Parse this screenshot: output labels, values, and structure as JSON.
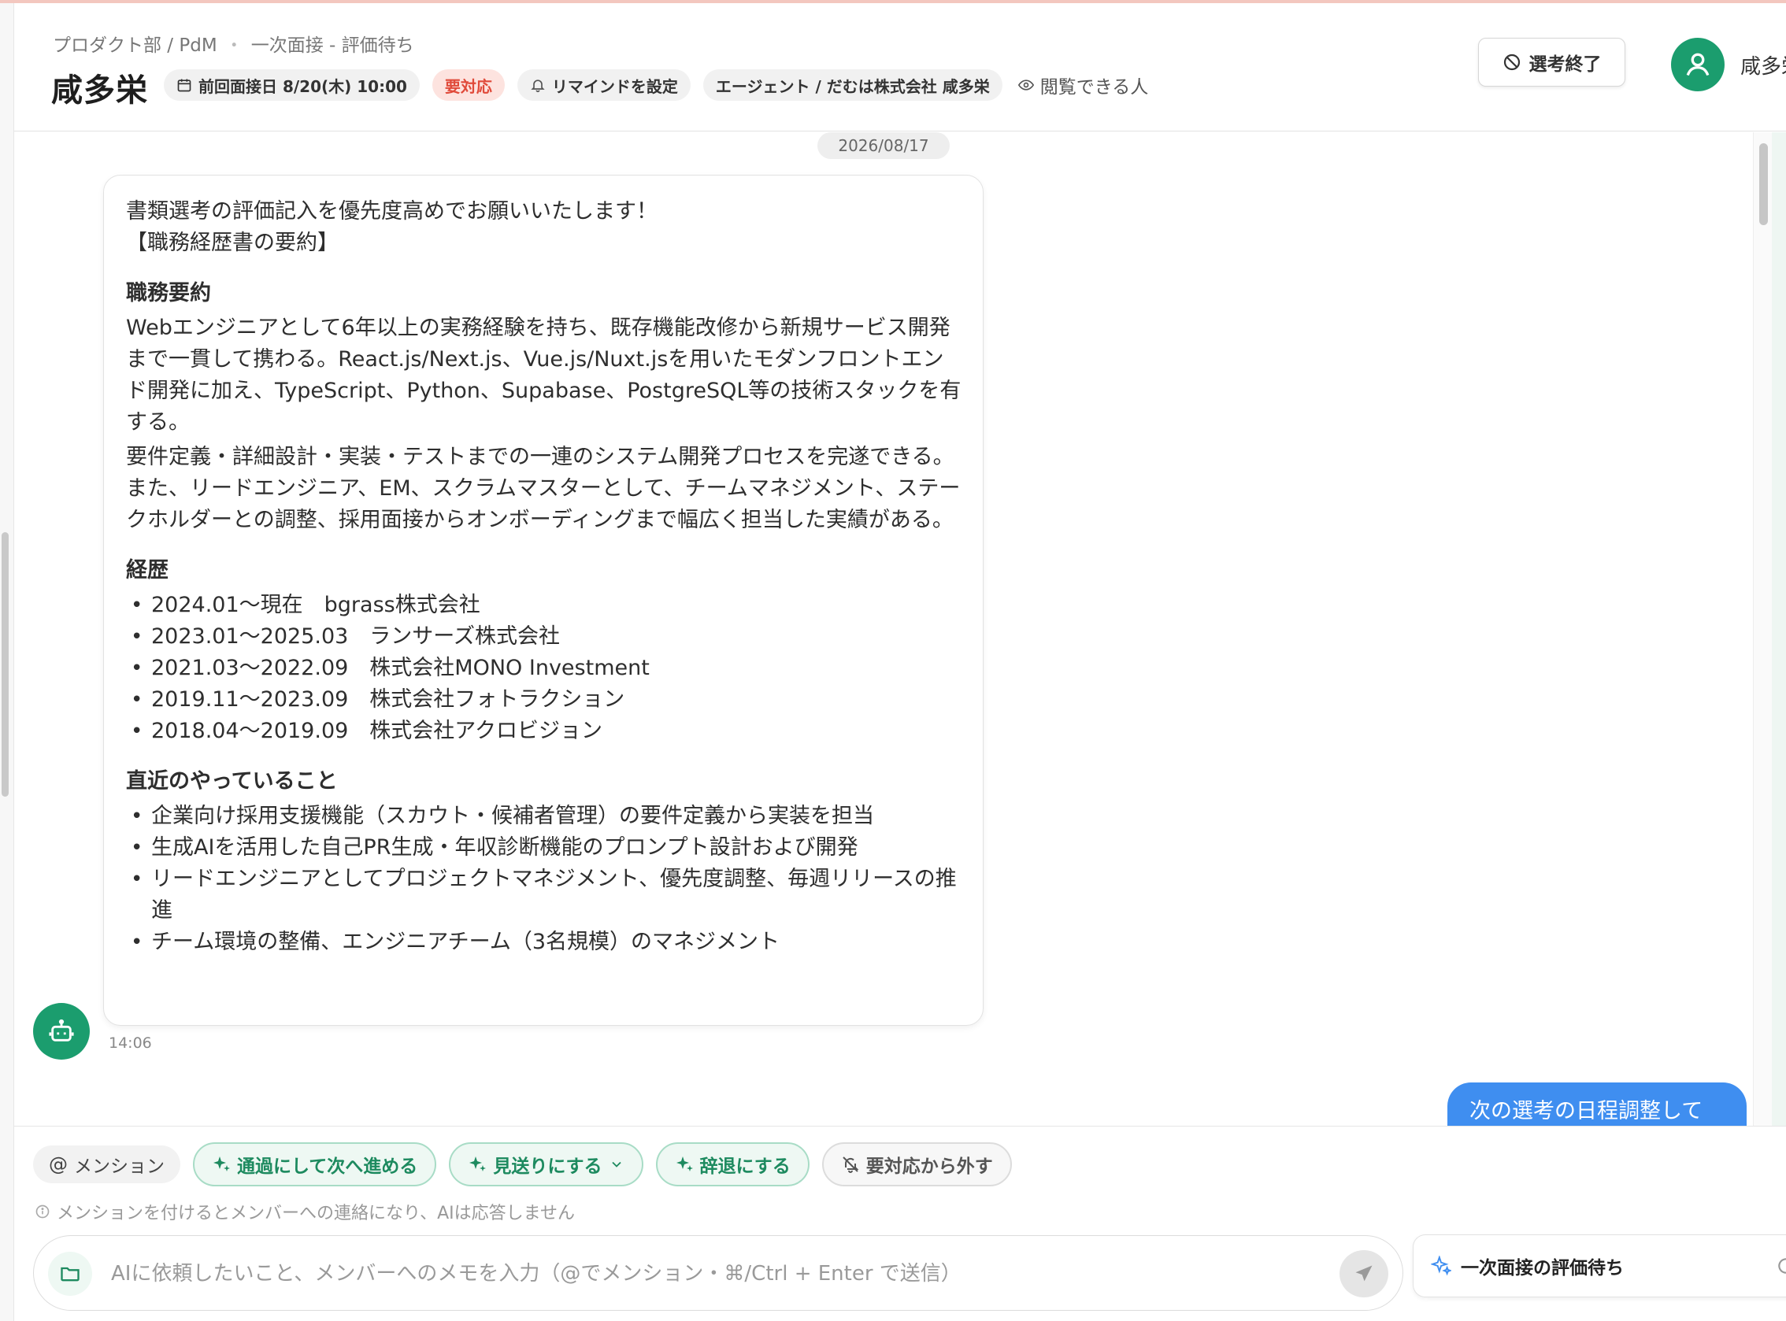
{
  "header": {
    "breadcrumb": {
      "dept": "プロダクト部 / PdM",
      "separator": "・",
      "stage": "一次面接 - 評価待ち"
    },
    "candidate_name": "咸多栄",
    "chips": {
      "last_interview": "前回面接日 8/20(木) 10:00",
      "urgent": "要対応",
      "reminder": "リマインドを設定",
      "agent": "エージェント / だむは株式会社 咸多栄",
      "viewers": "閲覧できる人"
    },
    "end_button": "選考終了",
    "user_name": "咸多栄"
  },
  "chat": {
    "date": "2026/08/17",
    "message": {
      "intro": "書類選考の評価記入を優先度高めでお願いいたします！",
      "section_title": "【職務経歴書の要約】",
      "summary_heading": "職務要約",
      "summary_p1": "Webエンジニアとして6年以上の実務経験を持ち、既存機能改修から新規サービス開発まで一貫して携わる。React.js/Next.js、Vue.js/Nuxt.jsを用いたモダンフロントエンド開発に加え、TypeScript、Python、Supabase、PostgreSQL等の技術スタックを有する。",
      "summary_p2": "要件定義・詳細設計・実装・テストまでの一連のシステム開発プロセスを完遂できる。また、リードエンジニア、EM、スクラムマスターとして、チームマネジメント、ステークホルダーとの調整、採用面接からオンボーディングまで幅広く担当した実績がある。",
      "history_heading": "経歴",
      "history": [
        "2024.01〜現在　bgrass株式会社",
        "2023.01〜2025.03　ランサーズ株式会社",
        "2021.03〜2022.09　株式会社MONO Investment",
        "2019.11〜2023.09　株式会社フォトラクション",
        "2018.04〜2019.09　株式会社アクロビジョン"
      ],
      "recent_heading": "直近のやっていること",
      "recent": [
        "企業向け採用支援機能（スカウト・候補者管理）の要件定義から実装を担当",
        "生成AIを活用した自己PR生成・年収診断機能のプロンプト設計および開発",
        "リードエンジニアとしてプロジェクトマネジメント、優先度調整、毎週リリースの推進",
        "チーム環境の整備、エンジニアチーム（3名規模）のマネジメント"
      ],
      "time": "14:06"
    },
    "user_message": "次の選考の日程調整して"
  },
  "actions": {
    "mention": "メンション",
    "pass": "通過にして次へ進める",
    "reject": "見送りにする",
    "decline": "辞退にする",
    "remove_urgent": "要対応から外す",
    "hint": "メンションを付けるとメンバーへの連絡になり、AIは応答しません",
    "input_placeholder": "AIに依頼したいこと、メンバーへのメモを入力（@でメンション・⌘/Ctrl + Enter で送信）",
    "input_value": "",
    "status_card": "一次面接の評価待ち"
  },
  "colors": {
    "brand_green": "#1b9d6e",
    "urgent_red": "#e04a3a",
    "user_bubble": "#3f8ef0"
  }
}
